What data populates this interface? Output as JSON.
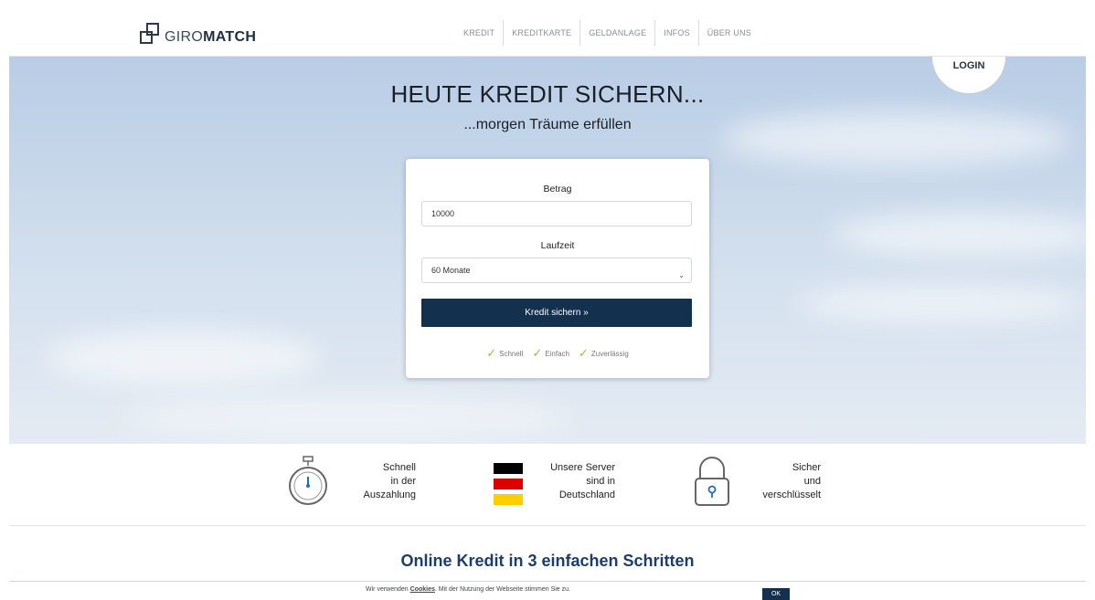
{
  "header": {
    "logo": {
      "text_thin": "GIRO",
      "text_bold": "MATCH",
      "icon": "giromatch-logo-icon"
    },
    "nav": [
      "KREDIT",
      "KREDITKARTE",
      "GELDANLAGE",
      "INFOS",
      "ÜBER UNS"
    ]
  },
  "hero": {
    "login_label": "LOGIN",
    "title": "HEUTE KREDIT SICHERN...",
    "subtitle": "...morgen Träume erfüllen"
  },
  "form": {
    "amount_label": "Betrag",
    "amount_value": "10000",
    "term_label": "Laufzeit",
    "term_value": "60 Monate",
    "submit_label": "Kredit sichern »",
    "features": [
      "Schnell",
      "Einfach",
      "Zuverlässig"
    ]
  },
  "usp": {
    "fast": {
      "lines": [
        "Schnell",
        "in der",
        "Auszahlung"
      ],
      "icon": "stopwatch-icon"
    },
    "servers": {
      "lines": [
        "Unsere Server",
        "sind in",
        "Deutschland"
      ],
      "icon": "german-flag-icon",
      "colors": [
        "#000000",
        "#dd0000",
        "#ffce00"
      ]
    },
    "secure": {
      "lines": [
        "Sicher",
        "und",
        "verschlüsselt"
      ],
      "icon": "padlock-icon"
    }
  },
  "section": {
    "title": "Online Kredit in 3 einfachen Schritten"
  },
  "cookie": {
    "text_before": "Wir verwenden ",
    "link": "Cookies",
    "text_after": ". Mit der Nutzung der Webseite stimmen Sie zu.",
    "ok_label": "OK"
  },
  "colors": {
    "primary": "#13304f",
    "check": "#8cc63f",
    "heading": "#1b3e6a"
  }
}
